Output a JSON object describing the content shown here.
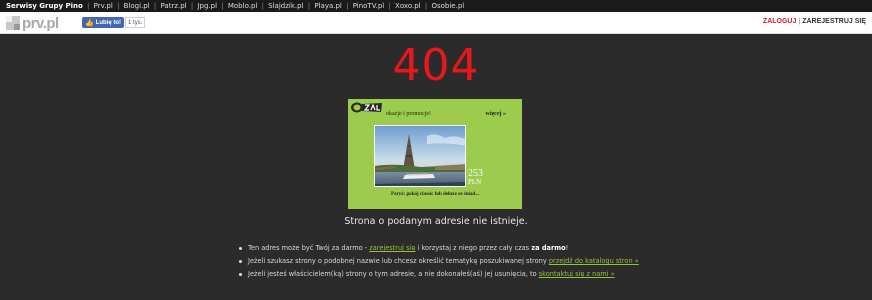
{
  "topnav": {
    "brand": "Serwisy Grupy Pino",
    "links": [
      "Prv.pl",
      "Blogi.pl",
      "Patrz.pl",
      "Jpg.pl",
      "Moblo.pl",
      "Slajdzik.pl",
      "Playa.pl",
      "PinoTV.pl",
      "Xoxo.pl",
      "Osobie.pl"
    ]
  },
  "header": {
    "logo_text": "prv.pl",
    "fb_label": "Lubię to!",
    "fb_count": "1 tys.",
    "login": "ZALOGUJ",
    "separator": "|",
    "register": "ZAREJESTRUJ SIĘ"
  },
  "error": {
    "code": "404",
    "message": "Strona o podanym adresie nie istnieje."
  },
  "ad": {
    "promo": "okazje i promocje!",
    "more": "więcej »",
    "price": "253",
    "currency": "PLN",
    "caption": "Paryż: pokój classic lub deluxe ze śniad..."
  },
  "tips": [
    {
      "pre": "Ten adres może być Twój za darmo - ",
      "link": "zarejestruj się",
      "mid": " i korzystaj z niego przez cały czas ",
      "bold": "za darmo",
      "post": "!"
    },
    {
      "pre": "Jeżeli szukasz strony o podobnej nazwie lub chcesz określić tematykę poszukiwanej strony ",
      "link": "przejdź do katalogu stron »"
    },
    {
      "pre": "Jeżeli jesteś właścicielem(ką) strony o tym adresie, a nie dokonałeś(aś) jej usunięcia, to ",
      "link": "skontaktuj się z nami »"
    }
  ],
  "colors": {
    "background": "#2b2b2b",
    "error_red": "#e8171c",
    "ad_green": "#9ccb4d",
    "link_green": "#8fc53d",
    "login_red": "#d0202a",
    "fb_blue": "#4267b2"
  }
}
